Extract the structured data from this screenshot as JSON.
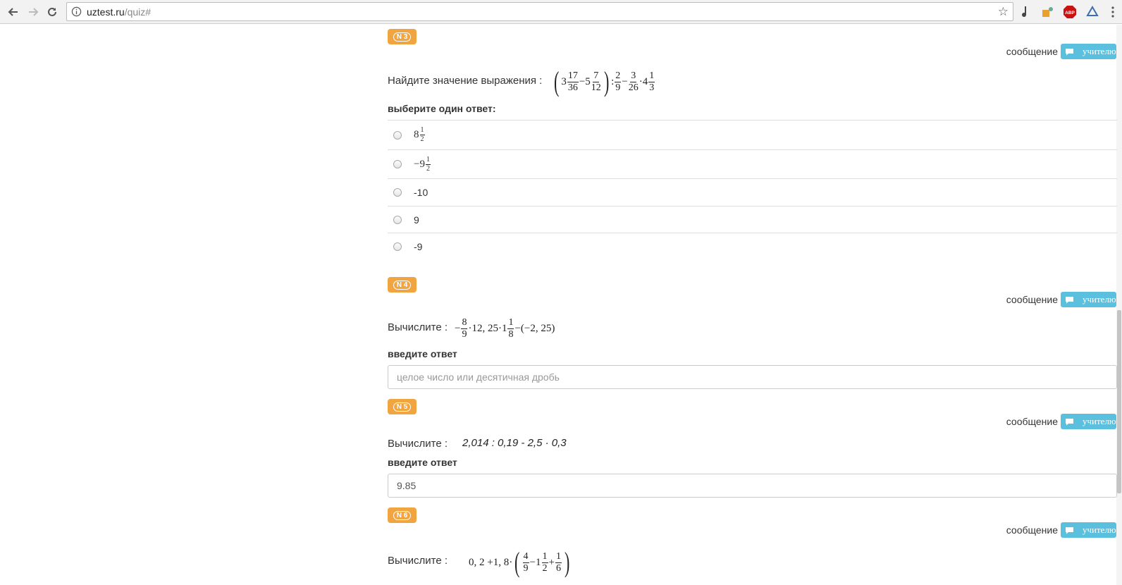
{
  "browser": {
    "url_host": "uztest.ru",
    "url_path": "/quiz#",
    "ext_abp": "ABP"
  },
  "page": {
    "message_label": "сообщение",
    "teacher_button": "учителю",
    "questions": [
      {
        "badge": "N 3",
        "label": "Найдите значение выражения :",
        "answer_prompt": "выберите один ответ:",
        "options": [
          {
            "whole": "8",
            "num": "1",
            "den": "2"
          },
          {
            "whole": "−9",
            "num": "1",
            "den": "2"
          },
          {
            "text": "-10"
          },
          {
            "text": "9"
          },
          {
            "text": "-9"
          }
        ],
        "expr": {
          "a_whole": "3",
          "a_num": "17",
          "a_den": "36",
          "minus1": "−",
          "b_whole": "5",
          "b_num": "7",
          "b_den": "12",
          "colon": ":",
          "c_num": "2",
          "c_den": "9",
          "minus2": "−",
          "d_num": "3",
          "d_den": "26",
          "dot": "·",
          "e_whole": "4",
          "e_num": "1",
          "e_den": "3"
        }
      },
      {
        "badge": "N 4",
        "label": "Вычислите :",
        "answer_prompt": "введите ответ",
        "input_placeholder": "целое число или десятичная дробь",
        "input_value": "",
        "expr": {
          "lead": "−",
          "f_num": "8",
          "f_den": "9",
          "mid": "·12, 25·1",
          "g_num": "1",
          "g_den": "8",
          "tail": "−(−2, 25)"
        }
      },
      {
        "badge": "N 5",
        "label": "Вычислите :",
        "answer_prompt": "введите ответ",
        "input_value": "9.85",
        "expr_text": "2,014 : 0,19 - 2,5 · 0,3"
      },
      {
        "badge": "N 6",
        "label": "Вычислите :",
        "expr": {
          "lead": "0, 2 +1, 8·",
          "h_num": "4",
          "h_den": "9",
          "minus": "−1",
          "i_num": "1",
          "i_den": "2",
          "plus": "+",
          "j_num": "1",
          "j_den": "6"
        }
      }
    ]
  }
}
